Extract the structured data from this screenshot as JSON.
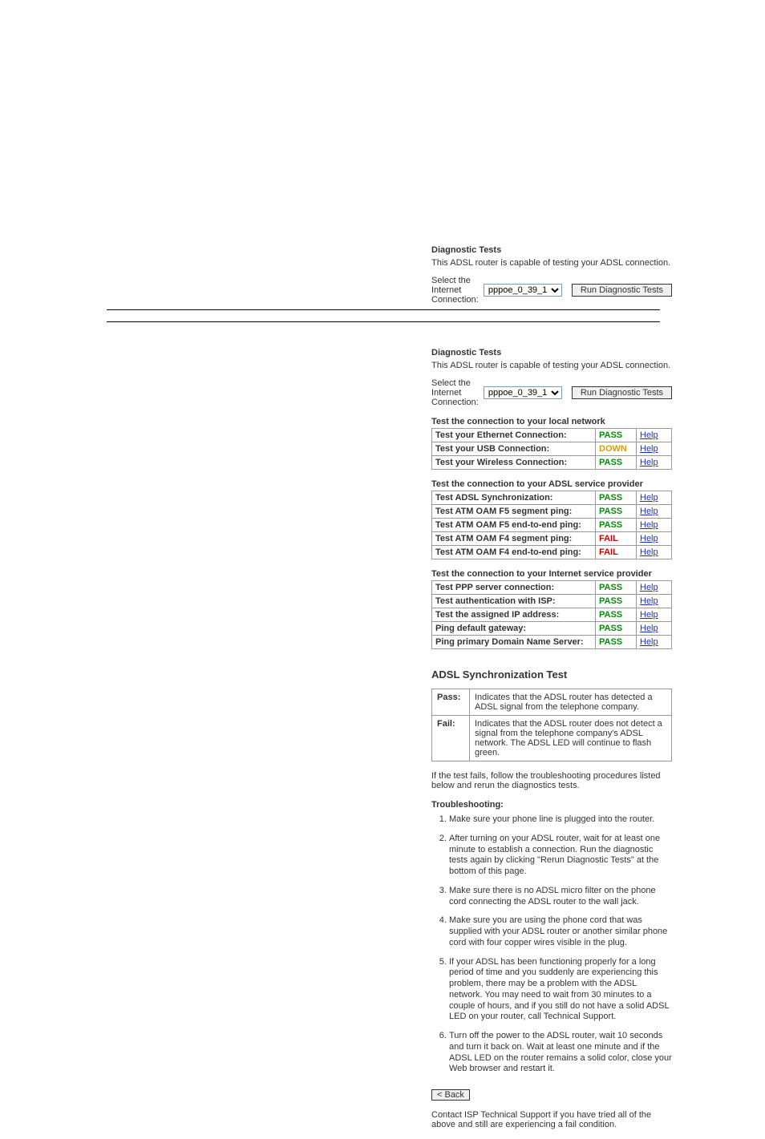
{
  "section1": {
    "title": "Diagnostic Tests",
    "intro": "This ADSL router is capable of testing your ADSL connection.",
    "select_label": "Select the Internet Connection:",
    "select_value": "pppoe_0_39_1",
    "button": "Run Diagnostic Tests"
  },
  "section2": {
    "title": "Diagnostic Tests",
    "intro": "This ADSL router is capable of testing your ADSL connection.",
    "select_label": "Select the Internet Connection:",
    "select_value": "pppoe_0_39_1",
    "button": "Run Diagnostic Tests"
  },
  "group1": {
    "title": "Test the connection to your local network",
    "rows": [
      {
        "label": "Test your Ethernet Connection:",
        "result": "PASS",
        "cls": "pass"
      },
      {
        "label": "Test your USB Connection:",
        "result": "DOWN",
        "cls": "down"
      },
      {
        "label": "Test your Wireless Connection:",
        "result": "PASS",
        "cls": "pass"
      }
    ]
  },
  "group2": {
    "title": "Test the connection to your ADSL service provider",
    "rows": [
      {
        "label": "Test ADSL Synchronization:",
        "result": "PASS",
        "cls": "pass"
      },
      {
        "label": "Test ATM OAM F5 segment ping:",
        "result": "PASS",
        "cls": "pass"
      },
      {
        "label": "Test ATM OAM F5 end-to-end ping:",
        "result": "PASS",
        "cls": "pass"
      },
      {
        "label": "Test ATM OAM F4 segment ping:",
        "result": "FAIL",
        "cls": "fail"
      },
      {
        "label": "Test ATM OAM F4 end-to-end ping:",
        "result": "FAIL",
        "cls": "fail"
      }
    ]
  },
  "group3": {
    "title": "Test the connection to your Internet service provider",
    "rows": [
      {
        "label": "Test PPP server connection:",
        "result": "PASS",
        "cls": "pass"
      },
      {
        "label": "Test authentication with ISP:",
        "result": "PASS",
        "cls": "pass"
      },
      {
        "label": "Test the assigned IP address:",
        "result": "PASS",
        "cls": "pass"
      },
      {
        "label": "Ping default gateway:",
        "result": "PASS",
        "cls": "pass"
      },
      {
        "label": "Ping primary Domain Name Server:",
        "result": "PASS",
        "cls": "pass"
      }
    ]
  },
  "help": "Help",
  "sync": {
    "title": "ADSL Synchronization Test",
    "pass_key": "Pass:",
    "pass_text": "Indicates that the ADSL router has detected a ADSL signal from the telephone company.",
    "fail_key": "Fail:",
    "fail_text": "Indicates that the ADSL router does not detect a signal from the telephone company's ADSL network. The ADSL LED will continue to flash green."
  },
  "afterfail": "If the test fails, follow the troubleshooting procedures listed below and rerun the diagnostics tests.",
  "ts_title": "Troubleshooting:",
  "ts": [
    "Make sure your phone line is plugged into the router.",
    "After turning on your ADSL router, wait for at least one minute to establish a connection. Run the diagnostic tests again by clicking \"Rerun Diagnostic Tests\" at the bottom of this page.",
    "Make sure there is no ADSL micro filter on the phone cord connecting the ADSL router to the wall jack.",
    "Make sure you are using the phone cord that was supplied with your ADSL router or another similar phone cord with four copper wires visible in the plug.",
    "If your ADSL has been functioning properly for a long period of time and you suddenly are experiencing this problem, there may be a problem with the ADSL network. You may need to wait from 30 minutes to a couple of hours, and if you still do not have a solid ADSL LED on your router, call Technical Support.",
    "Turn off the power to the ADSL router, wait 10 seconds and turn it back on. Wait at least one minute and if the ADSL LED on the router remains a solid color, close your Web browser and restart it."
  ],
  "back": "< Back",
  "contact": "Contact ISP Technical Support if you have tried all of the above and still are experiencing a fail condition."
}
